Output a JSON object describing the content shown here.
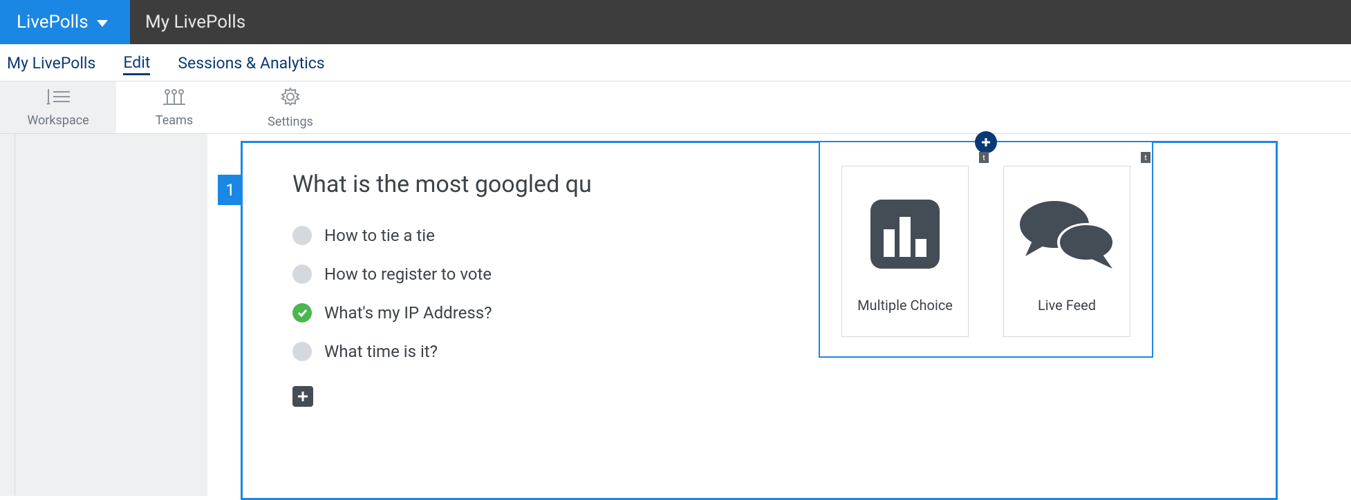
{
  "header": {
    "brand": "LivePolls",
    "page_title": "My LivePolls"
  },
  "subnav": {
    "items": [
      {
        "label": "My LivePolls"
      },
      {
        "label": "Edit"
      },
      {
        "label": "Sessions & Analytics"
      }
    ],
    "active_index": 1
  },
  "toolbar": {
    "items": [
      {
        "label": "Workspace",
        "icon": "workspace-icon"
      },
      {
        "label": "Teams",
        "icon": "teams-icon"
      },
      {
        "label": "Settings",
        "icon": "settings-icon"
      }
    ],
    "active_index": 0
  },
  "question": {
    "number": "1",
    "title": "What is the most googled qu",
    "options": [
      {
        "text": "How to tie a tie",
        "correct": false
      },
      {
        "text": "How to register to vote",
        "correct": false
      },
      {
        "text": "What's my IP Address?",
        "correct": true
      },
      {
        "text": "What time is it?",
        "correct": false
      }
    ]
  },
  "add_popover": {
    "types": [
      {
        "label": "Multiple Choice",
        "icon": "bar-chart-icon"
      },
      {
        "label": "Live Feed",
        "icon": "chat-icon"
      }
    ],
    "corner_tag": "t"
  }
}
